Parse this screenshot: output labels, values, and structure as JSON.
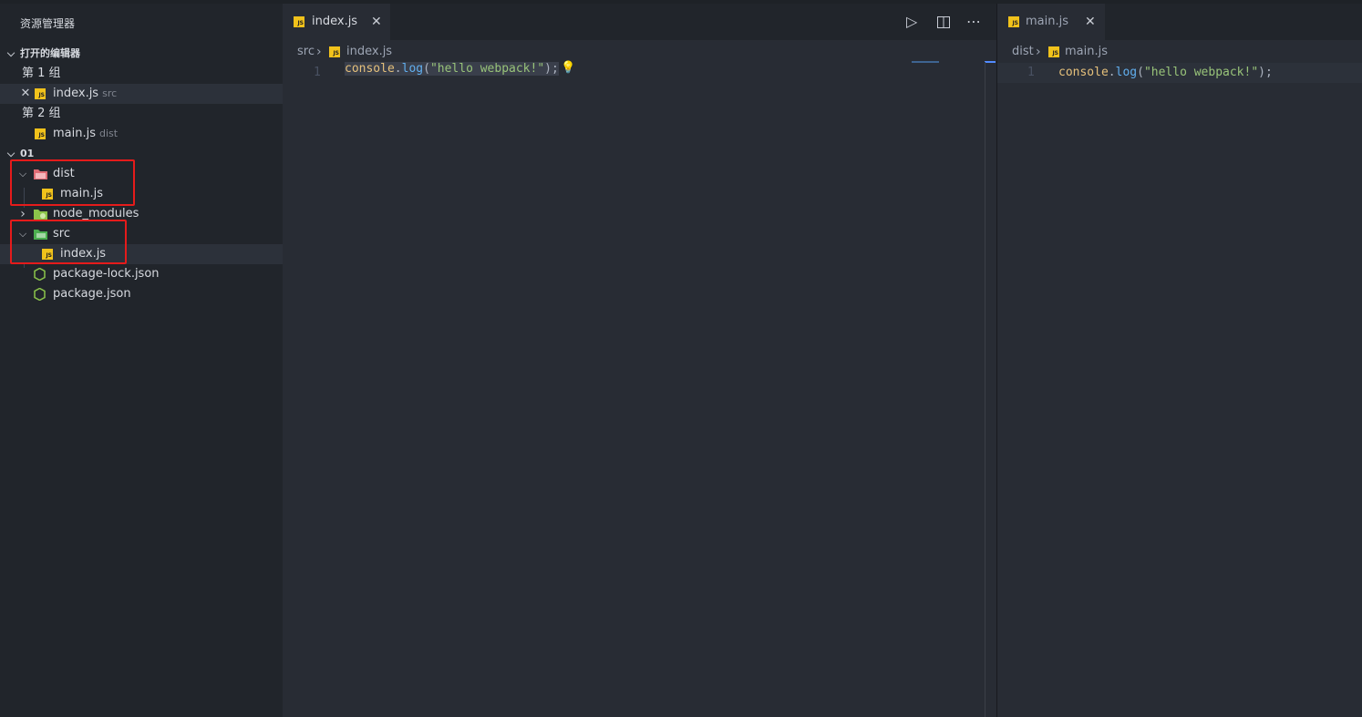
{
  "sidebar": {
    "title": "资源管理器",
    "open_editors": {
      "header": "打开的编辑器",
      "groups": [
        {
          "label": "第 1 组",
          "file": "index.js",
          "desc": "src"
        },
        {
          "label": "第 2 组",
          "file": "main.js",
          "desc": "dist"
        }
      ]
    },
    "folder": {
      "header": "01",
      "items": {
        "dist": "dist",
        "dist_main": "main.js",
        "node_modules": "node_modules",
        "src": "src",
        "src_index": "index.js",
        "package_lock": "package-lock.json",
        "package": "package.json"
      }
    }
  },
  "editor1": {
    "tab": "index.js",
    "breadcrumb": {
      "folder": "src",
      "file": "index.js"
    },
    "line_number": "1",
    "code": {
      "obj": "console",
      "dot": ".",
      "fn": "log",
      "open": "(",
      "str": "\"hello webpack!\"",
      "close": ");"
    }
  },
  "editor2": {
    "tab": "main.js",
    "breadcrumb": {
      "folder": "dist",
      "file": "main.js"
    },
    "line_number": "1",
    "code": {
      "obj": "console",
      "dot": ".",
      "fn": "log",
      "open": "(",
      "str": "\"hello webpack!\"",
      "close": ");"
    }
  },
  "icons": {
    "js": "JS",
    "chevron_down": "⌵",
    "chevron_right": "›",
    "close": "✕",
    "run": "▷",
    "more": "⋯",
    "bulb": "💡"
  },
  "colors": {
    "accent_highlight": "#e51b1b",
    "js_icon": "#f1c21b"
  }
}
